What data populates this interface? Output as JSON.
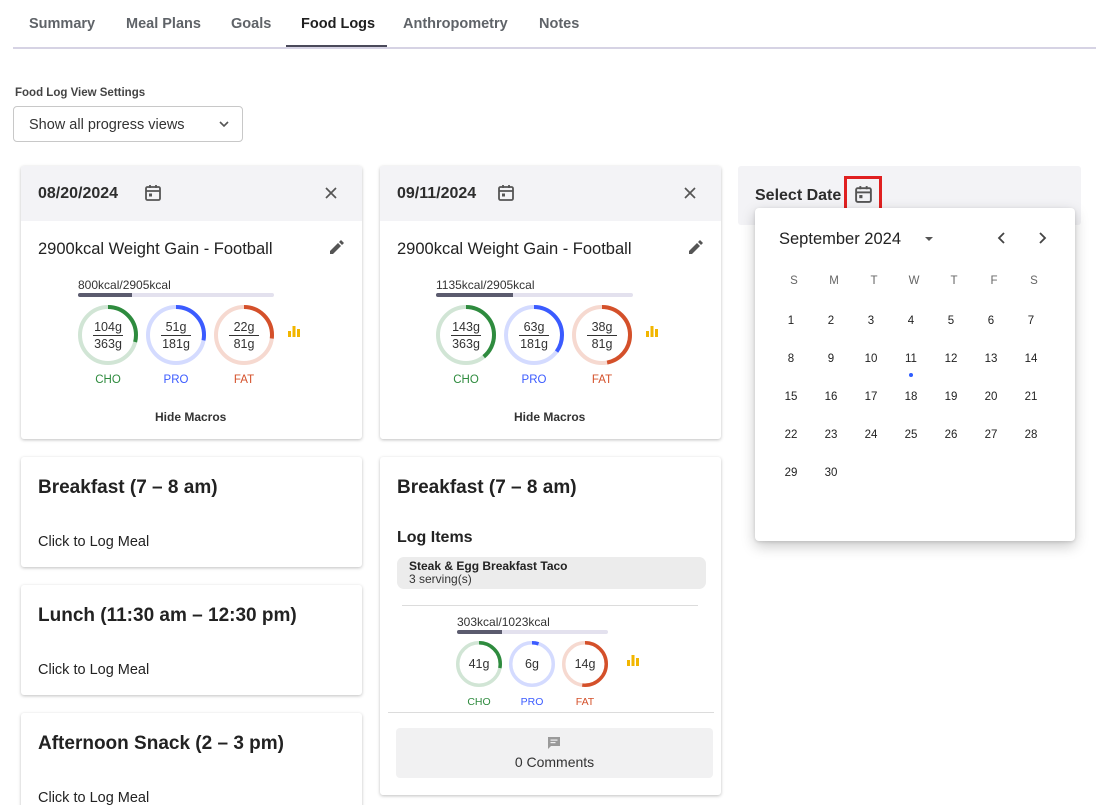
{
  "tabs": [
    {
      "label": "Summary"
    },
    {
      "label": "Meal Plans"
    },
    {
      "label": "Goals"
    },
    {
      "label": "Food Logs",
      "active": true
    },
    {
      "label": "Anthropometry"
    },
    {
      "label": "Notes"
    }
  ],
  "view_settings": {
    "label": "Food Log View Settings",
    "selected": "Show all progress views"
  },
  "colors": {
    "cho": "#2e8b3e",
    "pro": "#3b5bff",
    "fat": "#d4502a",
    "bar_icon": "#f2b600",
    "highlight": "#e02020"
  },
  "day1": {
    "date": "08/20/2024",
    "plan": "2900kcal Weight Gain - Football",
    "kcal": "800kcal/2905kcal",
    "kcal_progress": 0.275,
    "macros": {
      "cho": {
        "top": "104g",
        "bottom": "363g",
        "label": "CHO",
        "progress": 0.29
      },
      "pro": {
        "top": "51g",
        "bottom": "181g",
        "label": "PRO",
        "progress": 0.28
      },
      "fat": {
        "top": "22g",
        "bottom": "81g",
        "label": "FAT",
        "progress": 0.27
      }
    },
    "hide_macros": "Hide Macros",
    "meals": [
      {
        "title": "Breakfast (7 – 8 am)",
        "cta": "Click to Log Meal"
      },
      {
        "title": "Lunch (11:30 am – 12:30 pm)",
        "cta": "Click to Log Meal"
      },
      {
        "title": "Afternoon Snack (2 – 3 pm)",
        "cta": "Click to Log Meal"
      }
    ]
  },
  "day2": {
    "date": "09/11/2024",
    "plan": "2900kcal Weight Gain - Football",
    "kcal": "1135kcal/2905kcal",
    "kcal_progress": 0.39,
    "macros": {
      "cho": {
        "top": "143g",
        "bottom": "363g",
        "label": "CHO",
        "progress": 0.39
      },
      "pro": {
        "top": "63g",
        "bottom": "181g",
        "label": "PRO",
        "progress": 0.35
      },
      "fat": {
        "top": "38g",
        "bottom": "81g",
        "label": "FAT",
        "progress": 0.47
      }
    },
    "hide_macros": "Hide Macros",
    "breakfast": {
      "title": "Breakfast (7 – 8 am)",
      "log_items_title": "Log Items",
      "item_name": "Steak & Egg Breakfast Taco",
      "item_servings": "3 serving(s)",
      "kcal": "303kcal/1023kcal",
      "kcal_progress": 0.3,
      "macros": {
        "cho": {
          "value": "41g",
          "label": "CHO",
          "progress": 0.28
        },
        "pro": {
          "value": "6g",
          "label": "PRO",
          "progress": 0.05
        },
        "fat": {
          "value": "14g",
          "label": "FAT",
          "progress": 0.52
        }
      },
      "comments": "0 Comments"
    }
  },
  "select_date": {
    "label": "Select Date"
  },
  "calendar": {
    "month_label": "September 2024",
    "weekdays": [
      "S",
      "M",
      "T",
      "W",
      "T",
      "F",
      "S"
    ],
    "days": [
      "1",
      "2",
      "3",
      "4",
      "5",
      "6",
      "7",
      "8",
      "9",
      "10",
      "11",
      "12",
      "13",
      "14",
      "15",
      "16",
      "17",
      "18",
      "19",
      "20",
      "21",
      "22",
      "23",
      "24",
      "25",
      "26",
      "27",
      "28",
      "29",
      "30"
    ],
    "first_weekday": 0,
    "today": "11"
  }
}
